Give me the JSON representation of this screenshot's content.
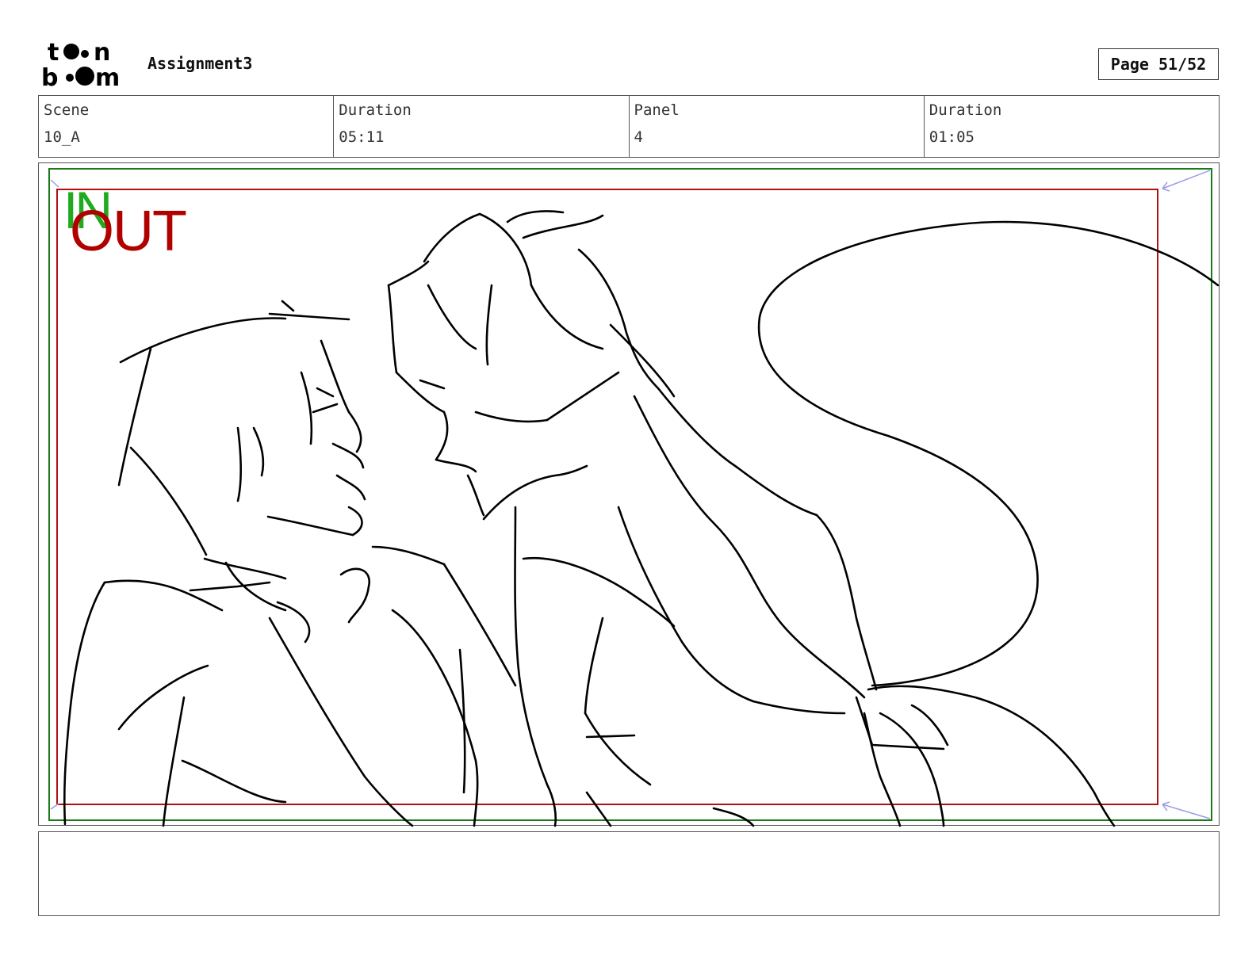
{
  "logo": {
    "line1": "toon",
    "line2": "boom"
  },
  "header": {
    "project_title": "Assignment3",
    "page_label": "Page 51/52"
  },
  "info": [
    {
      "label": "Scene",
      "value": "10_A"
    },
    {
      "label": "Duration",
      "value": "05:11"
    },
    {
      "label": "Panel",
      "value": "4"
    },
    {
      "label": "Duration",
      "value": "01:05"
    }
  ],
  "panel": {
    "in_label": "IN",
    "out_label": "OUT",
    "colors": {
      "safe_frame": "#1a7a1a",
      "action_frame": "#b01010",
      "sketch": "#000000"
    }
  },
  "notes": ""
}
